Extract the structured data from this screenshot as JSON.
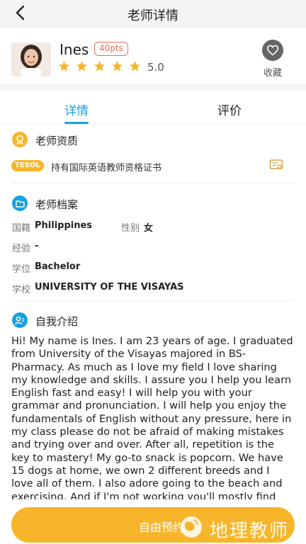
{
  "header": {
    "title": "老师详情",
    "back_icon": "back-arrow-icon"
  },
  "teacher": {
    "name": "Ines",
    "points_badge": "40pts",
    "rating": "5.0",
    "stars": 5,
    "favorite_label": "收藏"
  },
  "tabs": [
    {
      "label": "详情",
      "active": true
    },
    {
      "label": "评价",
      "active": false
    }
  ],
  "qualification": {
    "title": "老师资质",
    "badge": "TESOL",
    "text": "持有国际英语教师资格证书"
  },
  "profile": {
    "title": "老师档案",
    "fields": [
      {
        "label": "国籍",
        "value": "Philippines"
      },
      {
        "label": "性别",
        "value": "女"
      },
      {
        "label": "经验",
        "value": "-"
      },
      {
        "label": "学位",
        "value": "Bachelor"
      },
      {
        "label": "学校",
        "value": "UNIVERSITY OF THE VISAYAS"
      }
    ]
  },
  "intro": {
    "title": "自我介绍",
    "text": "Hi! My name is Ines. I am 23 years of age. I graduated from University of the Visayas majored in BS-Pharmacy. As much as I love my field I love sharing my knowledge and skills. I assure you I help you learn English fast and easy! I will help you with your grammar and pronunciation. I will help you enjoy the fundamentals of English without any pressure, here in my class please do not be afraid of making mistakes and trying over and over. After all, repetition is the key to mastery! My go-to snack is popcorn. We have 15 dogs at home, we own 2 different breeds and I love all of them. I also adore going to the beach and exercising. And if I'm not working you'll mostly find me reviewing/studying or singing and"
  },
  "cta": {
    "label": "自由预约"
  },
  "watermark": {
    "text": "地理教师"
  },
  "colors": {
    "accent": "#1aa2e0",
    "orange": "#f7b52a",
    "pts": "#e86a5f"
  }
}
